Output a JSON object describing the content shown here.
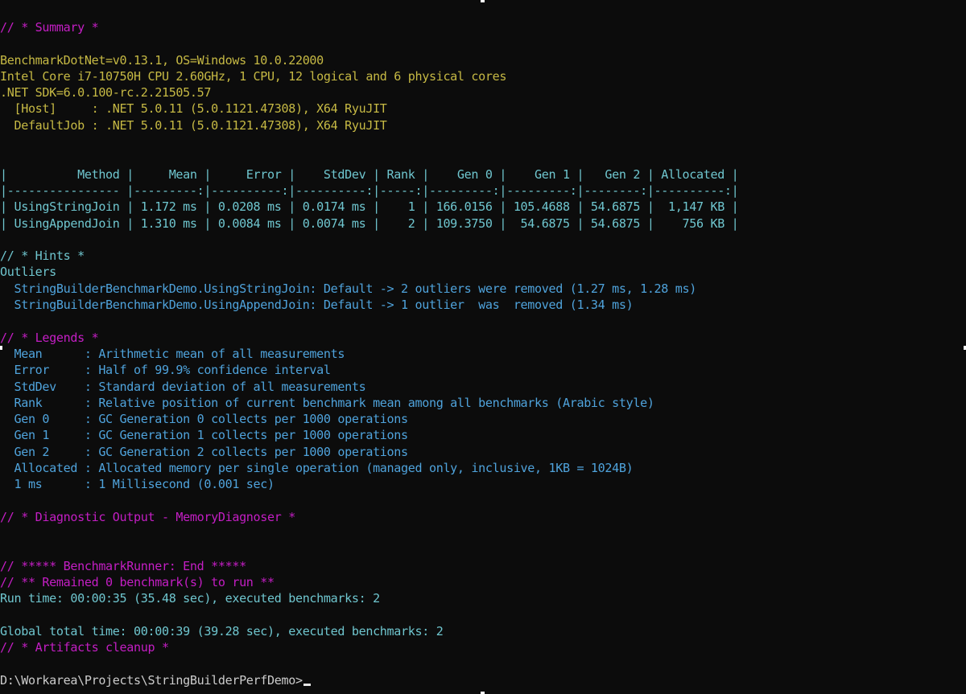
{
  "summary_header": "// * Summary *",
  "env": {
    "line1": "BenchmarkDotNet=v0.13.1, OS=Windows 10.0.22000",
    "line2": "Intel Core i7-10750H CPU 2.60GHz, 1 CPU, 12 logical and 6 physical cores",
    "line3": ".NET SDK=6.0.100-rc.2.21505.57",
    "line4": "  [Host]     : .NET 5.0.11 (5.0.1121.47308), X64 RyuJIT",
    "line5": "  DefaultJob : .NET 5.0.11 (5.0.1121.47308), X64 RyuJIT"
  },
  "table": {
    "header": "|          Method |     Mean |     Error |    StdDev | Rank |    Gen 0 |    Gen 1 |   Gen 2 | Allocated |",
    "separator": "|---------------- |---------:|----------:|----------:|-----:|---------:|---------:|--------:|----------:|",
    "rows": [
      "| UsingStringJoin | 1.172 ms | 0.0208 ms | 0.0174 ms |    1 | 166.0156 | 105.4688 | 54.6875 |  1,147 KB |",
      "| UsingAppendJoin | 1.310 ms | 0.0084 ms | 0.0074 ms |    2 | 109.3750 |  54.6875 | 54.6875 |    756 KB |"
    ]
  },
  "hints": {
    "header": "// * Hints *",
    "title": "Outliers",
    "line1": "  StringBuilderBenchmarkDemo.UsingStringJoin: Default -> 2 outliers were removed (1.27 ms, 1.28 ms)",
    "line2": "  StringBuilderBenchmarkDemo.UsingAppendJoin: Default -> 1 outlier  was  removed (1.34 ms)"
  },
  "legends": {
    "header": "// * Legends *",
    "items": [
      "  Mean      : Arithmetic mean of all measurements",
      "  Error     : Half of 99.9% confidence interval",
      "  StdDev    : Standard deviation of all measurements",
      "  Rank      : Relative position of current benchmark mean among all benchmarks (Arabic style)",
      "  Gen 0     : GC Generation 0 collects per 1000 operations",
      "  Gen 1     : GC Generation 1 collects per 1000 operations",
      "  Gen 2     : GC Generation 2 collects per 1000 operations",
      "  Allocated : Allocated memory per single operation (managed only, inclusive, 1KB = 1024B)",
      "  1 ms      : 1 Millisecond (0.001 sec)"
    ]
  },
  "diagnostic_header": "// * Diagnostic Output - MemoryDiagnoser *",
  "runner": {
    "end": "// ***** BenchmarkRunner: End *****",
    "remained": "// ** Remained 0 benchmark(s) to run **",
    "run_time": "Run time: 00:00:35 (35.48 sec), executed benchmarks: 2",
    "global_time": "Global total time: 00:00:39 (39.28 sec), executed benchmarks: 2",
    "artifacts": "// * Artifacts cleanup *"
  },
  "prompt": "D:\\Workarea\\Projects\\StringBuilderPerfDemo>",
  "colors": {
    "background": "#0c0c0c",
    "header_magenta": "#c41ec4",
    "env_yellow": "#c6b944",
    "table_cyan": "#6fc6cf",
    "legend_blue": "#4fa3dc",
    "text_white": "#cccccc"
  }
}
